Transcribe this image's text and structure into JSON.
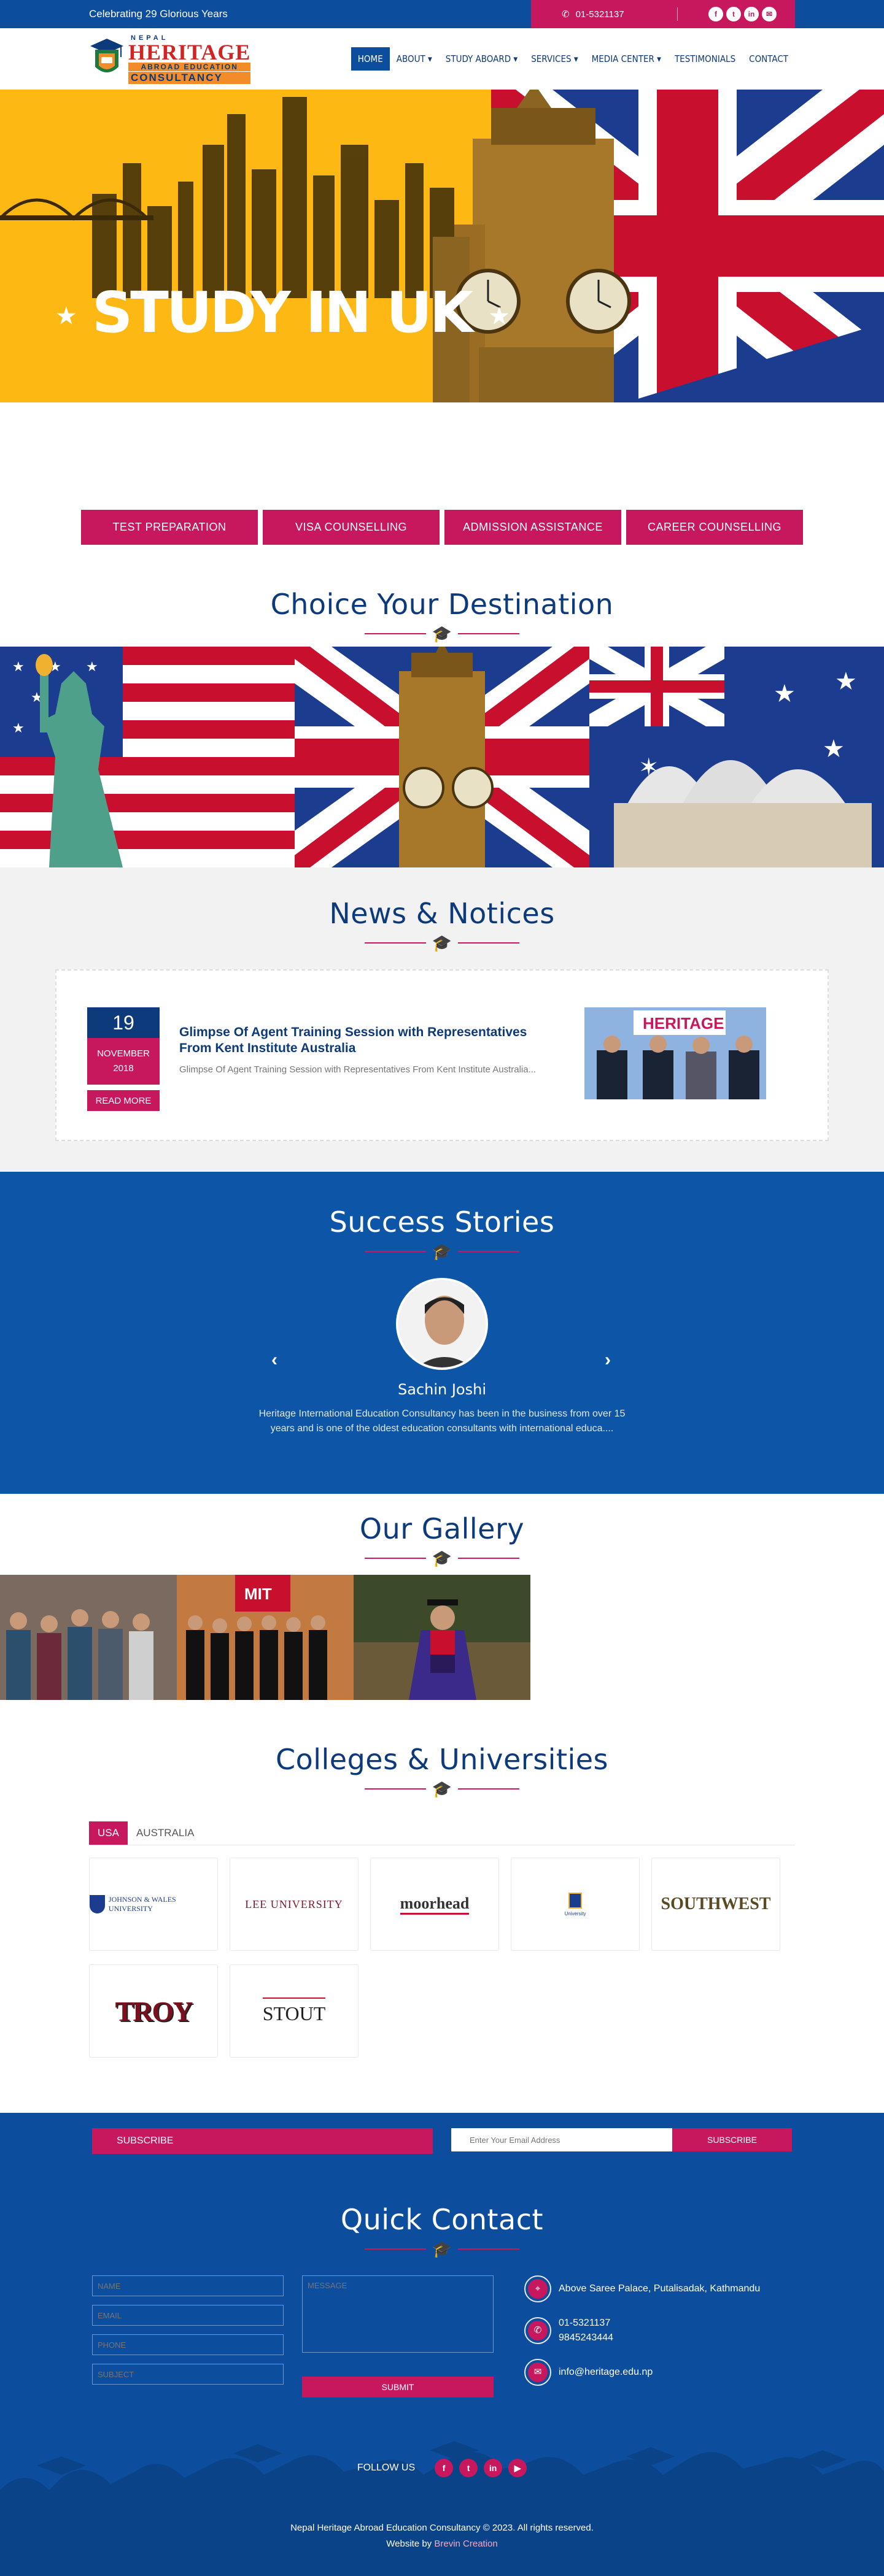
{
  "topbar": {
    "tagline": "Celebrating 29 Glorious Years",
    "phone": "01-5321137",
    "social": [
      "f",
      "t",
      "in",
      "✉"
    ]
  },
  "logo": {
    "line1": "NEPAL",
    "line2": "HERITAGE",
    "line3": "ABROAD EDUCATION",
    "line4": "CONSULTANCY"
  },
  "nav": [
    {
      "label": "HOME",
      "active": true
    },
    {
      "label": "ABOUT ▾"
    },
    {
      "label": "STUDY ABOARD ▾"
    },
    {
      "label": "SERVICES ▾"
    },
    {
      "label": "MEDIA CENTER ▾"
    },
    {
      "label": "TESTIMONIALS"
    },
    {
      "label": "CONTACT"
    }
  ],
  "hero": {
    "title": "STUDY IN UK"
  },
  "services": [
    "TEST PREPARATION",
    "VISA COUNSELLING",
    "ADMISSION ASSISTANCE",
    "CAREER COUNSELLING"
  ],
  "destination": {
    "title": "Choice Your Destination"
  },
  "news": {
    "title": "News & Notices",
    "item": {
      "day": "19",
      "month": "NOVEMBER",
      "year": "2018",
      "read_more": "READ MORE",
      "headline": "Glimpse Of Agent Training Session with Representatives From Kent Institute Australia",
      "excerpt": "Glimpse Of Agent Training Session with Representatives From Kent Institute Australia..."
    }
  },
  "success": {
    "title": "Success Stories",
    "name": "Sachin Joshi",
    "quote": "Heritage International Education Consultancy has been in the business from over 15 years and is one of the oldest education consultants with international educa...."
  },
  "gallery": {
    "title": "Our Gallery"
  },
  "colleges": {
    "title": "Colleges & Universities",
    "tabs": [
      "USA",
      "AUSTRALIA"
    ],
    "logos": [
      "JOHNSON & WALES UNIVERSITY",
      "LEE UNIVERSITY",
      "moorhead",
      "University",
      "SOUTHWEST",
      "TROY",
      "STOUT"
    ]
  },
  "subscribe": {
    "label": "SUBSCRIBE",
    "placeholder": "Enter Your Email Address",
    "button": "SUBSCRIBE"
  },
  "quick_contact": {
    "title": "Quick Contact",
    "placeholders": {
      "name": "NAME",
      "email": "EMAIL",
      "phone": "PHONE",
      "subject": "SUBJECT",
      "message": "MESSAGE"
    },
    "submit": "SUBMIT",
    "address": "Above Saree Palace, Putalisadak, Kathmandu",
    "phone1": "01-5321137",
    "phone2": "9845243444",
    "email": "info@heritage.edu.np"
  },
  "footer": {
    "follow": "FOLLOW US",
    "copyright": "Nepal Heritage Abroad Education Consultancy © 2023. All rights reserved.",
    "website_by": "Website by",
    "brand": "Brevin Creation"
  },
  "colors": {
    "primary": "#0d4d9e",
    "accent": "#c8185d",
    "navy": "#0d3a7a"
  }
}
